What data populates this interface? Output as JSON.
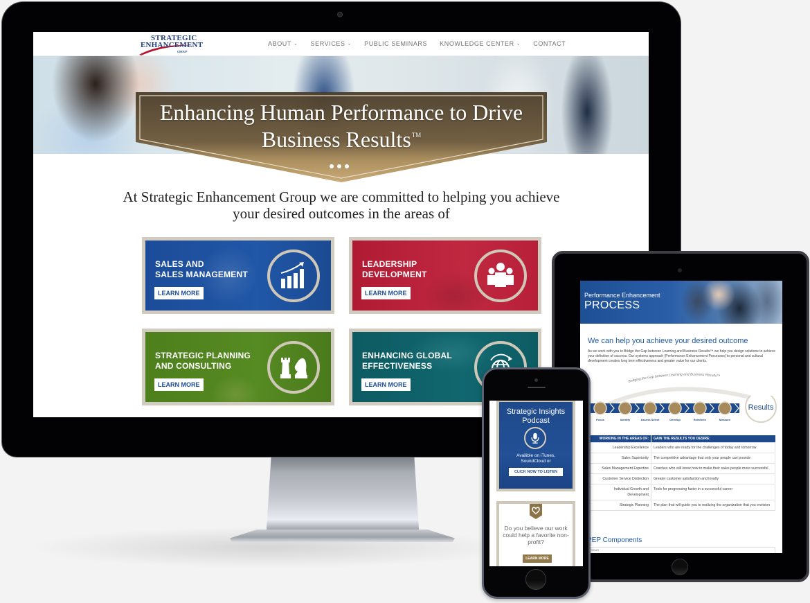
{
  "desktop": {
    "logo": {
      "line1": "STRATEGIC",
      "line2": "ENHANCEMENT",
      "line3": "GROUP"
    },
    "nav": [
      {
        "label": "ABOUT",
        "has_dropdown": true
      },
      {
        "label": "SERVICES",
        "has_dropdown": true
      },
      {
        "label": "PUBLIC SEMINARS",
        "has_dropdown": false
      },
      {
        "label": "KNOWLEDGE CENTER",
        "has_dropdown": true
      },
      {
        "label": "CONTACT",
        "has_dropdown": false
      }
    ],
    "dropdown_glyph": "⌄",
    "hero": {
      "title_line1": "Enhancing Human Performance to Drive",
      "title_line2": "Business Results",
      "trademark": "TM",
      "slide_count": 3
    },
    "intro": "At Strategic Enhancement Group we are committed to helping you achieve your desired outcomes in the areas of",
    "cards": [
      {
        "title_line1": "SALES AND",
        "title_line2": "SALES MANAGEMENT",
        "button": "LEARN MORE",
        "icon": "bar-chart-growth-icon",
        "color": "#1e4f9c"
      },
      {
        "title_line1": "LEADERSHIP",
        "title_line2": "DEVELOPMENT",
        "button": "LEARN MORE",
        "icon": "team-people-icon",
        "color": "#b51f35"
      },
      {
        "title_line1": "STRATEGIC PLANNING",
        "title_line2": "AND CONSULTING",
        "button": "LEARN MORE",
        "icon": "chess-pieces-icon",
        "color": "#4e7f1e"
      },
      {
        "title_line1": "ENHANCING GLOBAL",
        "title_line2": "EFFECTIVENESS",
        "button": "LEARN MORE",
        "icon": "globe-arrows-icon",
        "color": "#0f5f66"
      }
    ]
  },
  "tablet": {
    "hero_subtitle": "Performance Enhancement",
    "hero_title": "PROCESS",
    "heading": "We can help you achieve your desired outcome",
    "paragraph": "As we work with you to Bridge the Gap between Learning and Business Results™ we help you design solutions to achieve your definition of success. Our systems approach (Performance Enhancement Processes) to personal and cultural development creates long term effectiveness and greater value for our clients.",
    "arc_text": "Bridging the Gap between Learning and Business Results™",
    "steps": [
      "Focus",
      "Identify",
      "Assess Select",
      "Develop",
      "Reinforce",
      "Measure"
    ],
    "results_label": "Results",
    "table": {
      "headers": [
        "WORKING IN THE AREAS OF:",
        "GAIN THE RESULTS YOU DESIRE:"
      ],
      "rows": [
        [
          "Leadership Excellence",
          "Leaders who are ready for the challenges of today and tomorrow"
        ],
        [
          "Sales Superiority",
          "The competitive advantage that only your people can provide"
        ],
        [
          "Sales Management Expertise",
          "Coaches who will know how to make their sales people more successful"
        ],
        [
          "Customer Service Distinction",
          "Greater customer satisfaction and loyalty"
        ],
        [
          "Individual Growth and Development",
          "Tools for progressing faster in a successful career"
        ],
        [
          "Strategic Planning",
          "The plan that will guide you to realizing the organization that you envision"
        ]
      ]
    },
    "subheading": "PEP Components",
    "focus_label": "FOCUS"
  },
  "phone": {
    "podcast": {
      "title_line1": "Strategic Insights",
      "title_line2": "Podcast",
      "text_line1": "Availible on iTunes,",
      "text_line2": "SoundCloud or",
      "button": "CLICK NOW TO LISTEN"
    },
    "nonprofit": {
      "text": "Do you believe our work could help a favorite non-profit?",
      "button": "LEARN MORE"
    }
  }
}
